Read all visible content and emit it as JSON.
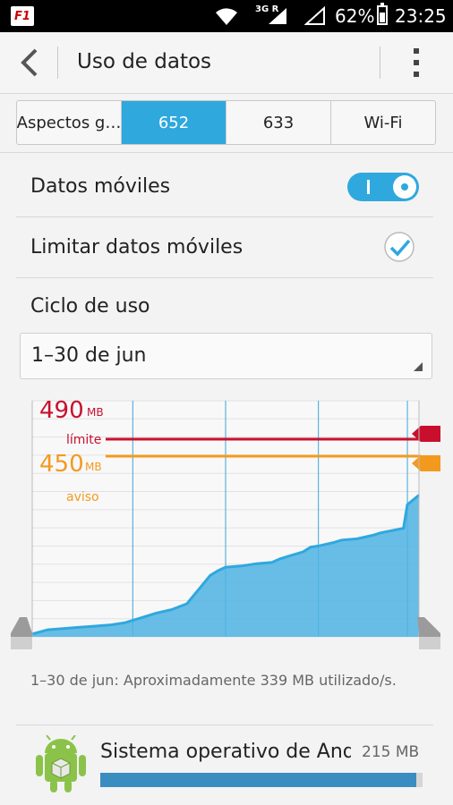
{
  "status_bar": {
    "app_icon_text": "F1",
    "network": "3G R",
    "battery": "62%",
    "battery_level": 0.62,
    "time": "23:25"
  },
  "action_bar": {
    "title": "Uso de datos"
  },
  "tabs": [
    {
      "label": "Aspectos g…",
      "active": false
    },
    {
      "label": "652",
      "active": true
    },
    {
      "label": "633",
      "active": false
    },
    {
      "label": "Wi-Fi",
      "active": false
    }
  ],
  "settings": {
    "mobile_data_label": "Datos móviles",
    "mobile_data_on": true,
    "limit_label": "Limitar datos móviles",
    "limit_checked": true,
    "cycle_label": "Ciclo de uso",
    "cycle_value": "1–30 de jun"
  },
  "chart_data": {
    "type": "area",
    "limit": {
      "value": "490",
      "unit": "MB",
      "label": "límite",
      "color": "#c8102e"
    },
    "warning": {
      "value": "450",
      "unit": "MB",
      "label": "aviso",
      "color": "#f39a1e"
    },
    "fill_color": "#4fb3e3",
    "line_color": "#2fa8de",
    "grid": true,
    "x": [
      0,
      0.04,
      0.08,
      0.12,
      0.16,
      0.2,
      0.24,
      0.28,
      0.32,
      0.36,
      0.4,
      0.42,
      0.44,
      0.46,
      0.48,
      0.5,
      0.54,
      0.58,
      0.62,
      0.64,
      0.66,
      0.7,
      0.72,
      0.74,
      0.78,
      0.8,
      0.84,
      0.88,
      0.9,
      0.93,
      0.96,
      0.97,
      1.0
    ],
    "y": [
      0.012,
      0.03,
      0.035,
      0.04,
      0.045,
      0.05,
      0.06,
      0.08,
      0.1,
      0.115,
      0.14,
      0.18,
      0.22,
      0.26,
      0.28,
      0.295,
      0.3,
      0.31,
      0.315,
      0.33,
      0.34,
      0.36,
      0.38,
      0.385,
      0.4,
      0.41,
      0.415,
      0.43,
      0.44,
      0.45,
      0.46,
      0.56,
      0.6
    ]
  },
  "summary": "1–30 de jun: Aproximadamente 339 MB utilizado/s.",
  "apps": [
    {
      "name": "Sistema operativo de Android",
      "size": "215 MB",
      "usage": 0.98
    }
  ]
}
